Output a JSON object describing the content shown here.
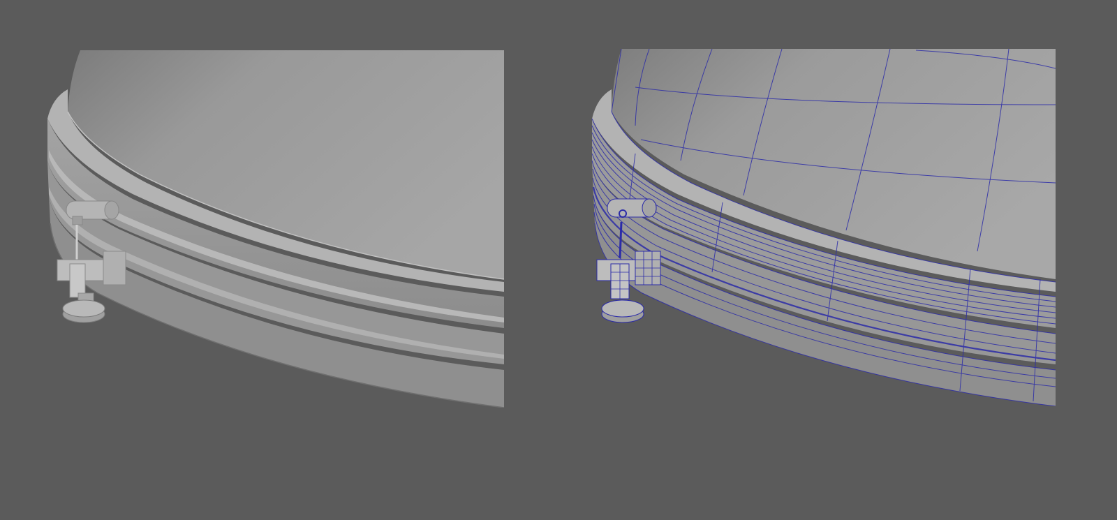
{
  "colors": {
    "background": "#5b5b5b",
    "surface_light": "#a9a9a9",
    "surface_mid": "#9a9a9a",
    "surface_dark": "#7e7e7e",
    "wireframe": "#2b2ba8"
  },
  "panels": [
    {
      "name": "shaded-render",
      "shading": "smooth-shaded",
      "wireframe": false
    },
    {
      "name": "wireframe-on-shaded-render",
      "shading": "smooth-shaded",
      "wireframe": true
    }
  ]
}
